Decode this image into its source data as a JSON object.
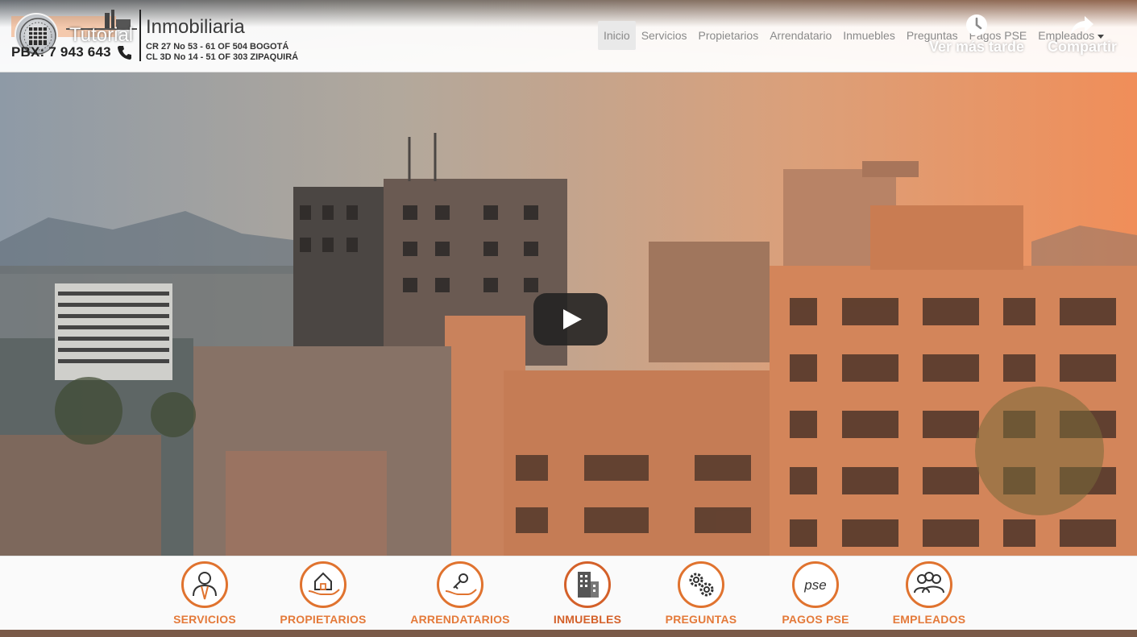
{
  "video": {
    "title": "Tutorial",
    "watch_later_label": "Ver más tarde",
    "share_label": "Compartir"
  },
  "header": {
    "phone": "PBX: 7 943 643",
    "brand": "Inmobiliaria",
    "address_1": "CR 27 No 53 - 61 OF 504 BOGOTÁ",
    "address_2": "CL 3D No 14 - 51 OF 303 ZIPAQUIRÁ"
  },
  "nav": {
    "items": [
      "Inicio",
      "Servicios",
      "Propietarios",
      "Arrendatario",
      "Inmuebles",
      "Preguntas",
      "Pagos PSE",
      "Empleados"
    ],
    "active": "Inicio"
  },
  "services": [
    {
      "label": "SERVICIOS",
      "icon": "agent-icon"
    },
    {
      "label": "PROPIETARIOS",
      "icon": "house-hand-icon"
    },
    {
      "label": "ARRENDATARIOS",
      "icon": "key-hand-icon"
    },
    {
      "label": "INMUEBLES",
      "icon": "building-icon"
    },
    {
      "label": "PREGUNTAS",
      "icon": "gears-icon"
    },
    {
      "label": "PAGOS PSE",
      "icon": "pse-icon"
    },
    {
      "label": "EMPLEADOS",
      "icon": "team-icon"
    }
  ],
  "pse_text": "pse",
  "colors": {
    "accent": "#e47a3a",
    "nav_text": "#8a8a8a"
  }
}
